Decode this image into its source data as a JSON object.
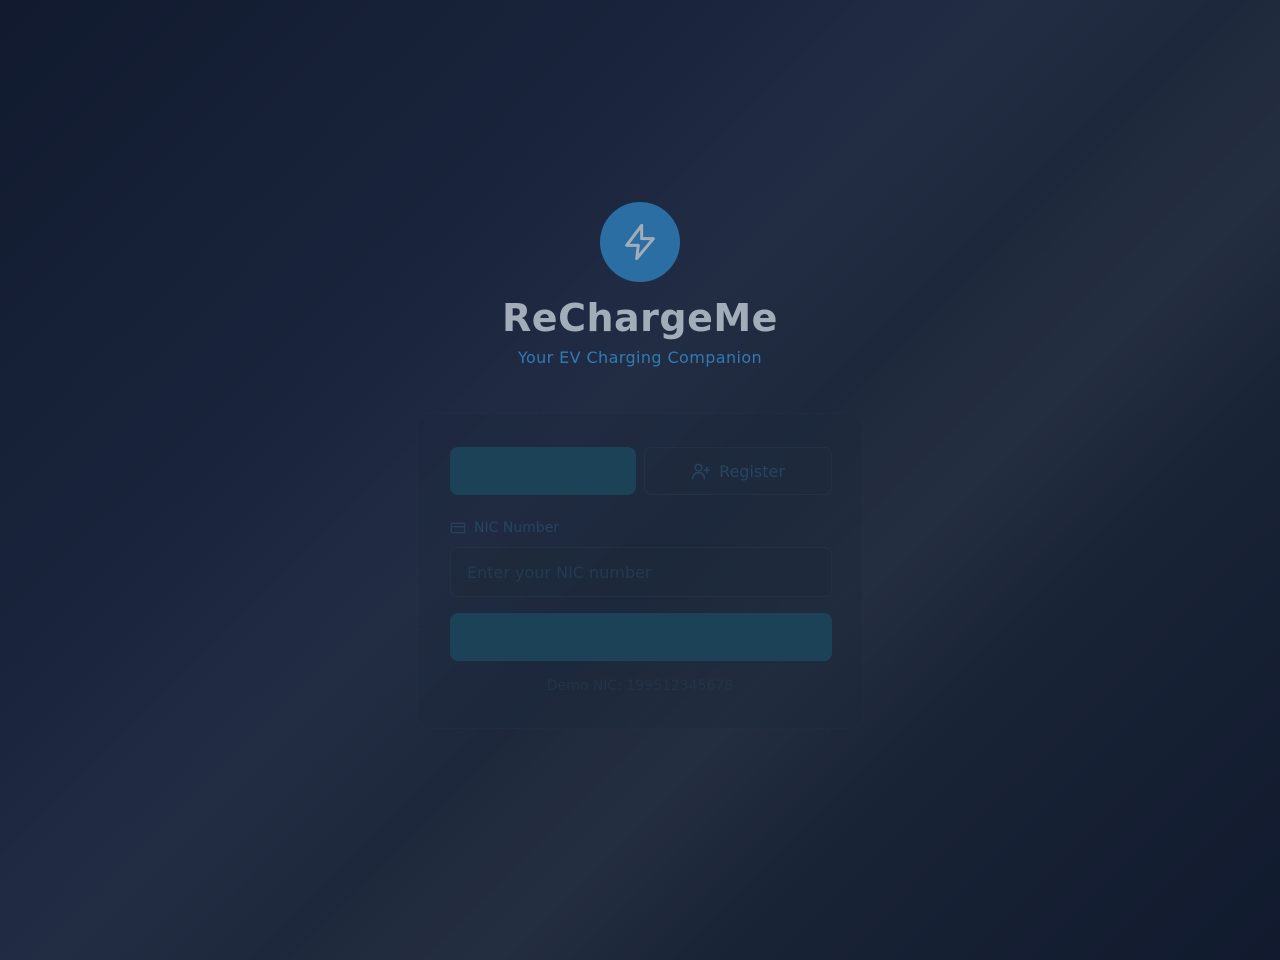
{
  "brand": {
    "logo_icon": "lightning-bolt-icon",
    "title": "ReChargeMe",
    "subtitle": "Your EV Charging Companion"
  },
  "auth": {
    "tabs": [
      {
        "id": "login",
        "label": "",
        "active": true
      },
      {
        "id": "register",
        "label": "Register",
        "icon": "user-plus-icon",
        "active": false
      }
    ],
    "nic_field": {
      "label": "NIC Number",
      "icon": "id-card-icon",
      "placeholder": "Enter your NIC number",
      "value": ""
    },
    "submit_label": "",
    "demo_hint": "Demo NIC: 199512345678"
  },
  "colors": {
    "accent": "#2b6ea3",
    "subtitle": "#2f7ab3",
    "button": "#1c4258",
    "background": "#1c2740"
  }
}
